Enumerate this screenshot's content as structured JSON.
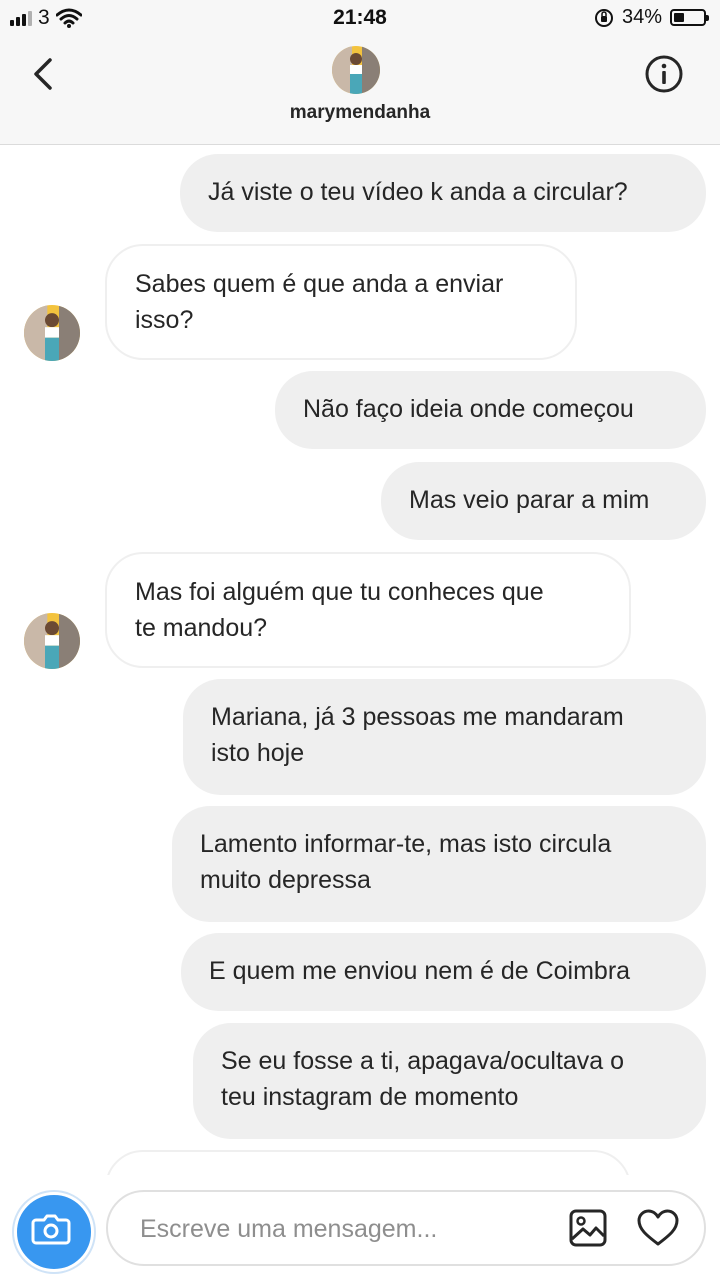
{
  "status": {
    "carrier": "3",
    "time": "21:48",
    "battery": "34%",
    "battery_level": 0.34
  },
  "header": {
    "username": "marymendanha"
  },
  "messages": [
    {
      "side": "sent",
      "text": "Já viste o teu vídeo k anda a circular?"
    },
    {
      "side": "received",
      "text": "Sabes quem é que anda a enviar\nisso?"
    },
    {
      "side": "sent",
      "text": "Não faço ideia onde começou"
    },
    {
      "side": "sent",
      "text": "Mas veio parar a mim"
    },
    {
      "side": "received",
      "text": "Mas foi alguém que tu conheces que\nte mandou?"
    },
    {
      "side": "sent",
      "text": "Mariana, já 3 pessoas me mandaram\nisto hoje"
    },
    {
      "side": "sent",
      "text": "Lamento informar-te, mas isto circula\nmuito depressa"
    },
    {
      "side": "sent",
      "text": "E quem me enviou nem é de Coimbra"
    },
    {
      "side": "sent",
      "text": "Se eu fosse a ti, apagava/ocultava o\nteu instagram de momento"
    }
  ],
  "composer": {
    "placeholder": "Escreve uma mensagem..."
  },
  "colors": {
    "sent_bubble": "#efefef",
    "camera_button": "#3897f0"
  }
}
